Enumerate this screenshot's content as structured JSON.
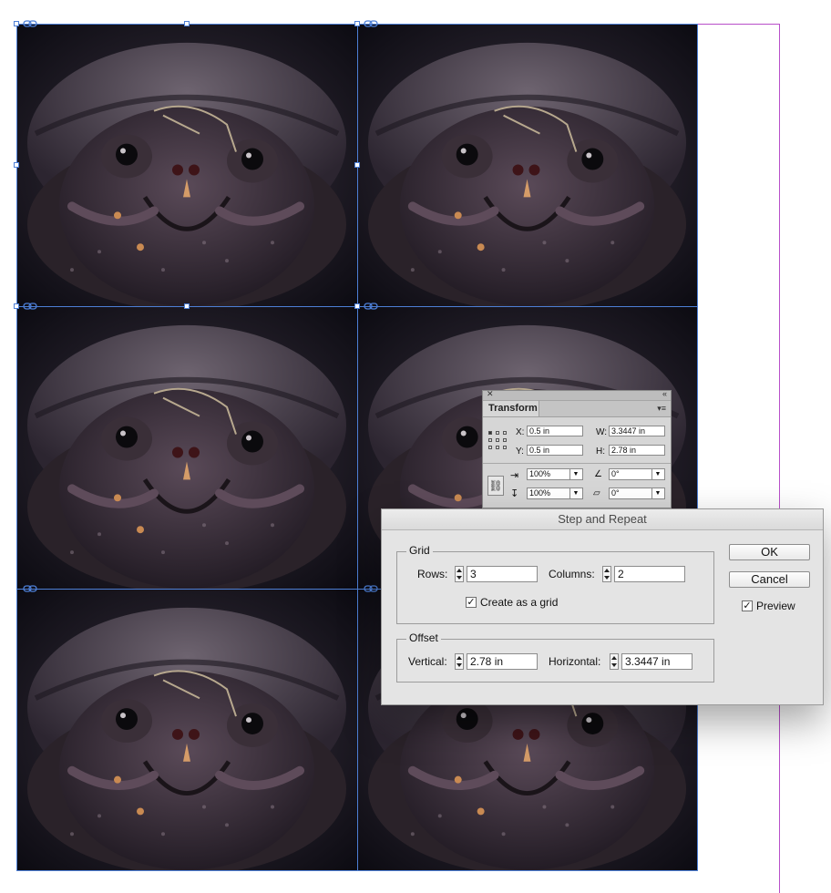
{
  "canvas": {
    "image_alt": "snapping turtle close-up photo",
    "frames_rows": 3,
    "frames_cols": 2
  },
  "transform_panel": {
    "tab_label": "Transform",
    "x_label": "X:",
    "x_value": "0.5 in",
    "y_label": "Y:",
    "y_value": "0.5 in",
    "w_label": "W:",
    "w_value": "3.3447 in",
    "h_label": "H:",
    "h_value": "2.78 in",
    "scale_x": "100%",
    "scale_y": "100%",
    "rotate": "0°",
    "shear": "0°"
  },
  "dialog": {
    "title": "Step and Repeat",
    "grid_legend": "Grid",
    "rows_label": "Rows:",
    "rows_value": "3",
    "columns_label": "Columns:",
    "columns_value": "2",
    "create_grid_label": "Create as a grid",
    "create_grid_checked": true,
    "offset_legend": "Offset",
    "vertical_label": "Vertical:",
    "vertical_value": "2.78 in",
    "horizontal_label": "Horizontal:",
    "horizontal_value": "3.3447 in",
    "ok_label": "OK",
    "cancel_label": "Cancel",
    "preview_label": "Preview",
    "preview_checked": true
  },
  "colors": {
    "frame_border": "#4d7fd6",
    "page_guide": "#b84fc9",
    "dialog_bg": "#e4e4e4"
  }
}
